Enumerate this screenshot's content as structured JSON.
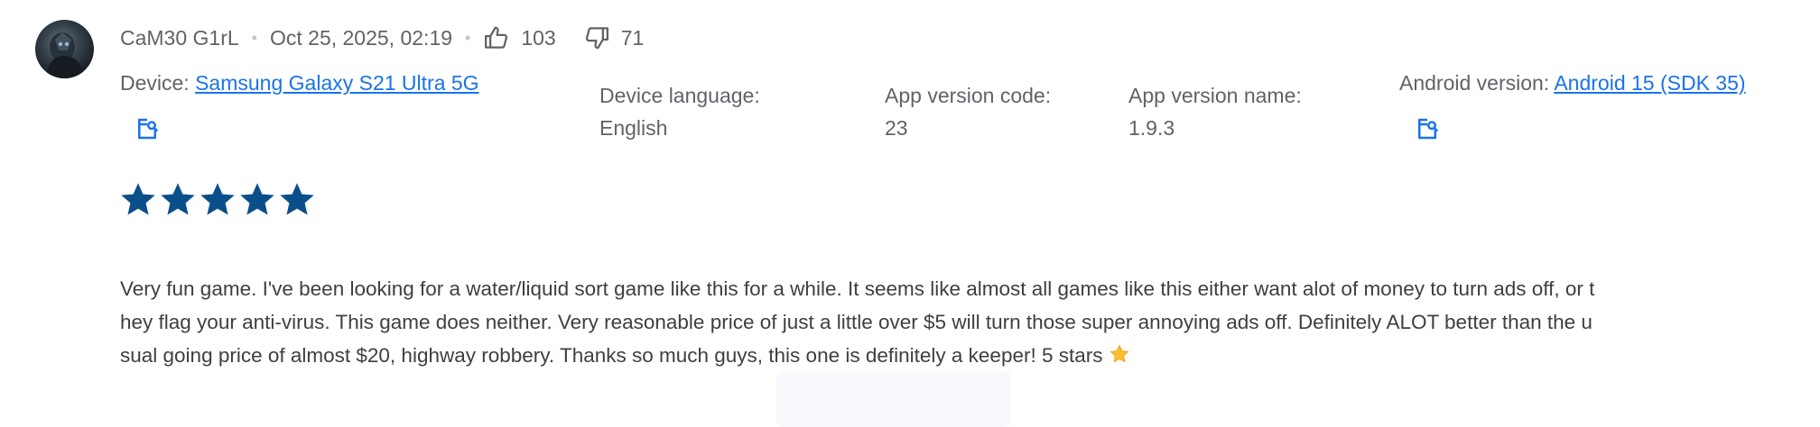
{
  "review": {
    "author": "CaM30 G1rL",
    "date": "Oct 25, 2025, 02:19",
    "thumbs_up_count": "103",
    "thumbs_down_count": "71",
    "rating": 5,
    "rating_max": 5,
    "text": "Very fun game. I've been looking for a water/liquid sort game like this for a while. It seems like almost all games like this either want alot of money to turn ads off, or they flag your anti-virus. This game does neither. Very reasonable price of just a little over $5 will turn those super annoying ads off. Definitely ALOT better than the usual going price of almost $20, highway robbery. Thanks so much guys, this one is definitely a keeper! 5 stars",
    "text_emoji": "star"
  },
  "details": {
    "device_label": "Device:",
    "device_value": "Samsung Galaxy S21 Ultra 5G",
    "language_label": "Device language:",
    "language_value": "English",
    "version_code_label": "App version code:",
    "version_code_value": "23",
    "version_name_label": "App version name:",
    "version_name_value": "1.9.3",
    "android_label": "Android version:",
    "android_value": "Android 15 (SDK 35)"
  },
  "icons": {
    "thumbs_up": "thumbs-up-icon",
    "thumbs_down": "thumbs-down-icon",
    "open_external": "open-in-new-icon",
    "star": "star-icon"
  },
  "colors": {
    "star": "#0b4f8a",
    "link": "#1a73e8",
    "text": "#3c4043",
    "muted": "#5f6368"
  }
}
